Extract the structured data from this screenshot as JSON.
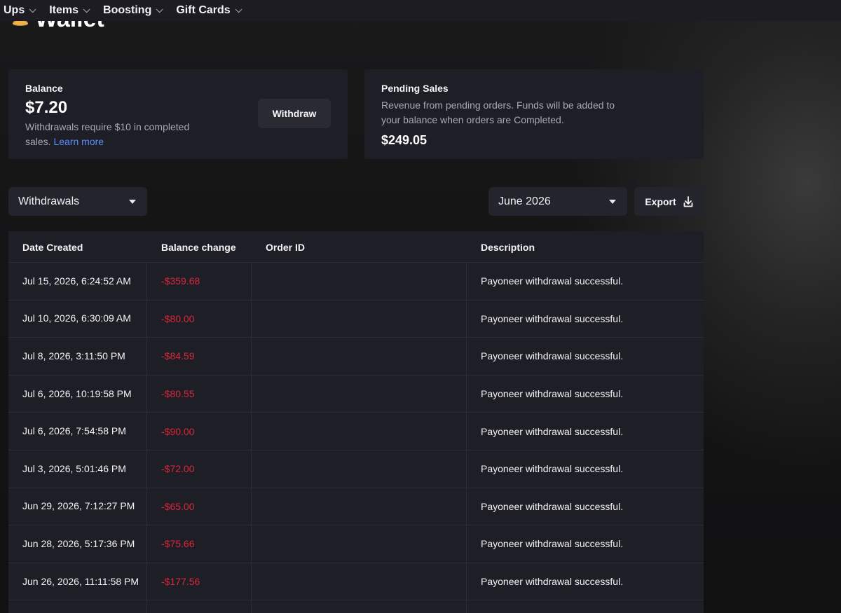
{
  "nav": {
    "items": [
      {
        "label": "Ups"
      },
      {
        "label": "Items"
      },
      {
        "label": "Boosting"
      },
      {
        "label": "Gift Cards"
      }
    ]
  },
  "page": {
    "title": "Wallet",
    "icon": "coin-stack-icon"
  },
  "balance_card": {
    "label": "Balance",
    "amount": "$7.20",
    "note": "Withdrawals require $10 in completed sales.",
    "learn_more": "Learn more",
    "withdraw_label": "Withdraw"
  },
  "pending_card": {
    "label": "Pending Sales",
    "note": "Revenue from pending orders. Funds will be added to your balance when orders are Completed.",
    "amount": "$249.05"
  },
  "filters": {
    "type_selected": "Withdrawals",
    "month_selected": "June 2026",
    "export_label": "Export"
  },
  "table": {
    "columns": [
      "Date Created",
      "Balance change",
      "Order ID",
      "Description"
    ],
    "rows": [
      {
        "date": "Jul 15, 2026, 6:24:52 AM",
        "change": "-$359.68",
        "order_id": "",
        "description": "Payoneer withdrawal successful."
      },
      {
        "date": "Jul 10, 2026, 6:30:09 AM",
        "change": "-$80.00",
        "order_id": "",
        "description": "Payoneer withdrawal successful."
      },
      {
        "date": "Jul 8, 2026, 3:11:50 PM",
        "change": "-$84.59",
        "order_id": "",
        "description": "Payoneer withdrawal successful."
      },
      {
        "date": "Jul 6, 2026, 10:19:58 PM",
        "change": "-$80.55",
        "order_id": "",
        "description": "Payoneer withdrawal successful."
      },
      {
        "date": "Jul 6, 2026, 7:54:58 PM",
        "change": "-$90.00",
        "order_id": "",
        "description": "Payoneer withdrawal successful."
      },
      {
        "date": "Jul 3, 2026, 5:01:46 PM",
        "change": "-$72.00",
        "order_id": "",
        "description": "Payoneer withdrawal successful."
      },
      {
        "date": "Jun 29, 2026, 7:12:27 PM",
        "change": "-$65.00",
        "order_id": "",
        "description": "Payoneer withdrawal successful."
      },
      {
        "date": "Jun 28, 2026, 5:17:36 PM",
        "change": "-$75.66",
        "order_id": "",
        "description": "Payoneer withdrawal successful."
      },
      {
        "date": "Jun 26, 2026, 11:11:58 PM",
        "change": "-$177.56",
        "order_id": "",
        "description": "Payoneer withdrawal successful."
      }
    ]
  },
  "colors": {
    "negative": "#d9283a",
    "link": "#5b8cff",
    "card_bg": "#1e1e26",
    "coin": "#f0b24a"
  }
}
